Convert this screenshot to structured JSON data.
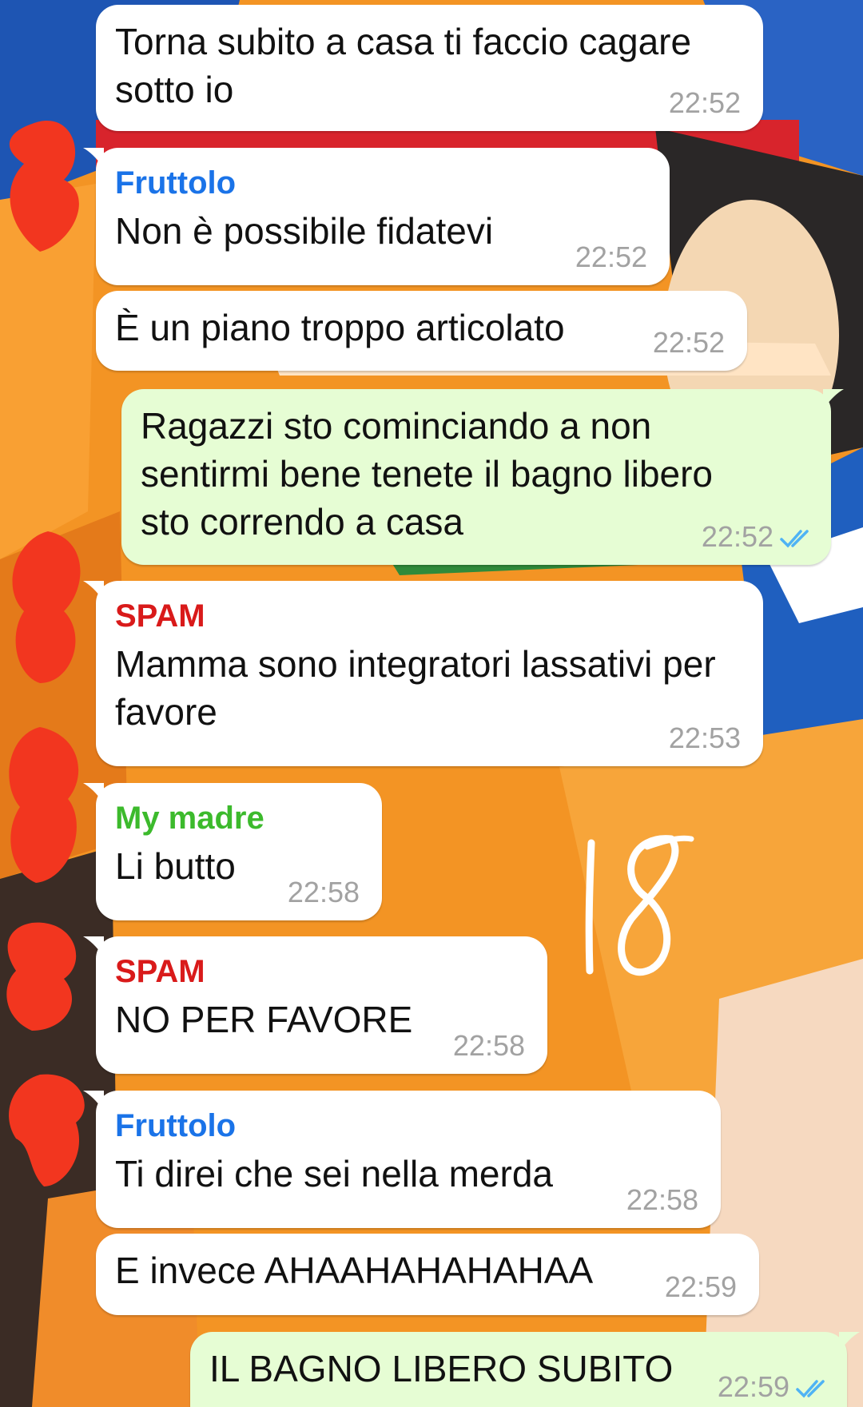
{
  "wallpaper": {
    "description_colors": {
      "orange": "#f39424",
      "blue": "#1e55b3",
      "red": "#d8242c",
      "dark": "#2a2727"
    }
  },
  "colors": {
    "incoming_bubble": "#ffffff",
    "outgoing_bubble": "#e6fdd4",
    "timestamp": "#a2a2a2",
    "read_ticks": "#4fb3f4",
    "sender_fruttolo": "#1a73e8",
    "sender_spam": "#d91a1a",
    "sender_my_madre": "#3cba2c",
    "redaction": "#f2361f"
  },
  "messages": [
    {
      "text": "Torna subito a casa ti faccio cagare sotto io",
      "time": "22:52"
    },
    {
      "sender": "Fruttolo",
      "text": "Non è possibile fidatevi",
      "time": "22:52"
    },
    {
      "text": "È un piano troppo articolato",
      "time": "22:52"
    },
    {
      "text": "Ragazzi sto cominciando a non sentirmi bene tenete il bagno libero sto correndo a casa",
      "time": "22:52",
      "status": "read"
    },
    {
      "sender": "SPAM",
      "text": "Mamma sono integratori lassativi per favore",
      "time": "22:53"
    },
    {
      "sender": "My madre",
      "text": "Li butto",
      "time": "22:58"
    },
    {
      "sender": "SPAM",
      "text": "NO PER FAVORE",
      "time": "22:58"
    },
    {
      "sender": "Fruttolo",
      "text": "Ti direi che sei nella merda",
      "time": "22:58"
    },
    {
      "text": "E invece AHAAHAHAHAHAA",
      "time": "22:59"
    },
    {
      "text": "IL BAGNO LIBERO SUBITO",
      "time": "22:59",
      "status": "read"
    }
  ],
  "overlay": {
    "handwritten_number": "18"
  }
}
